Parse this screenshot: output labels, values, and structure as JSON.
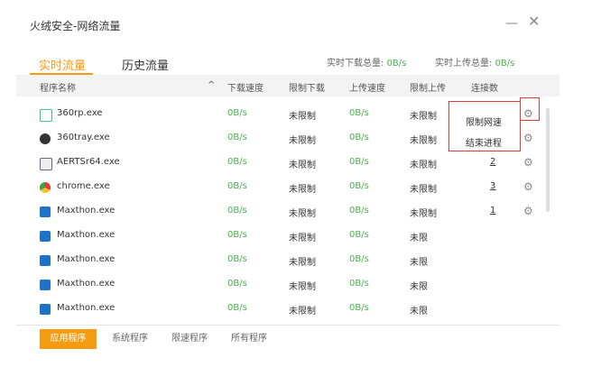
{
  "window": {
    "title": "火绒安全-网络流量",
    "minimize_label": "—",
    "close_label": "✕"
  },
  "tabs": [
    {
      "label": "实时流量",
      "active": true
    },
    {
      "label": "历史流量",
      "active": false
    }
  ],
  "totals": {
    "download_label": "实时下载总量: ",
    "download_value": "0B/s",
    "upload_label": "实时上传总量: ",
    "upload_value": "0B/s"
  },
  "columns": [
    "程序名称",
    "下载速度",
    "限制下载",
    "上传速度",
    "限制上传",
    "连接数"
  ],
  "sort_indicator": "^",
  "rows": [
    {
      "name": "360rp.exe",
      "icon": "360rp-icon",
      "down": "0B/s",
      "limit_down": "未限制",
      "up": "0B/s",
      "limit_up": "未限制",
      "conn": ""
    },
    {
      "name": "360tray.exe",
      "icon": "360tray-icon",
      "down": "0B/s",
      "limit_down": "未限制",
      "up": "0B/s",
      "limit_up": "未限制",
      "conn": ""
    },
    {
      "name": "AERTSr64.exe",
      "icon": "aertsr-icon",
      "down": "0B/s",
      "limit_down": "未限制",
      "up": "0B/s",
      "limit_up": "未限制",
      "conn": "2"
    },
    {
      "name": "chrome.exe",
      "icon": "chrome-icon",
      "down": "0B/s",
      "limit_down": "未限制",
      "up": "0B/s",
      "limit_up": "未限制",
      "conn": "3"
    },
    {
      "name": "Maxthon.exe",
      "icon": "maxthon-icon",
      "down": "0B/s",
      "limit_down": "未限制",
      "up": "0B/s",
      "limit_up": "未限制",
      "conn": "1"
    },
    {
      "name": "Maxthon.exe",
      "icon": "maxthon-icon",
      "down": "0B/s",
      "limit_down": "未限制",
      "up": "0B/s",
      "limit_up": "未限",
      "conn": ""
    },
    {
      "name": "Maxthon.exe",
      "icon": "maxthon-icon",
      "down": "0B/s",
      "limit_down": "未限制",
      "up": "0B/s",
      "limit_up": "未限",
      "conn": ""
    },
    {
      "name": "Maxthon.exe",
      "icon": "maxthon-icon",
      "down": "0B/s",
      "limit_down": "未限制",
      "up": "0B/s",
      "limit_up": "未限",
      "conn": ""
    },
    {
      "name": "Maxthon.exe",
      "icon": "maxthon-icon",
      "down": "0B/s",
      "limit_down": "未限制",
      "up": "0B/s",
      "limit_up": "未限",
      "conn": ""
    }
  ],
  "context_menu": {
    "items": [
      "限制网速",
      "结束进程"
    ]
  },
  "footer": {
    "buttons": [
      "应用程序",
      "系统程序",
      "限速程序",
      "所有程序"
    ]
  },
  "colors": {
    "accent": "#f39c12",
    "speed": "#4caf50",
    "highlight": "#e53935"
  }
}
